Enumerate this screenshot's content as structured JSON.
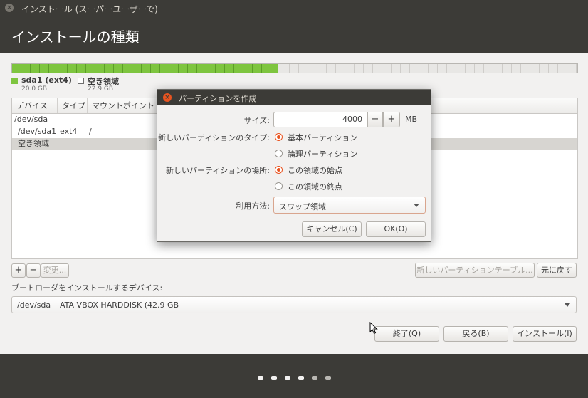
{
  "window": {
    "title": "インストール (スーパーユーザーで)"
  },
  "header": {
    "title": "インストールの種類"
  },
  "disk_usage": {
    "used_fraction": 0.47,
    "used_color": "#7ec53f"
  },
  "legend": [
    {
      "name": "sda1 (ext4)",
      "size": "20.0 GB",
      "color": "#7ec53f"
    },
    {
      "name": "空き領域",
      "size": "22.9 GB",
      "color": "#ffffff"
    }
  ],
  "table": {
    "columns": [
      "デバイス",
      "タイプ",
      "マウントポイント"
    ],
    "rows": [
      {
        "device": "/dev/sda",
        "type": "",
        "mount": ""
      },
      {
        "device": "/dev/sda1",
        "type": "ext4",
        "mount": "/"
      },
      {
        "device": "空き領域",
        "type": "",
        "mount": ""
      }
    ]
  },
  "toolbar": {
    "add": "+",
    "remove": "−",
    "change": "変更...",
    "new_table": "新しいパーティションテーブル...",
    "revert": "元に戻す"
  },
  "bootloader": {
    "label": "ブートローダをインストールするデバイス:",
    "device": "/dev/sda",
    "description": "ATA VBOX HARDDISK (42.9 GB"
  },
  "buttons": {
    "quit": "終了(Q)",
    "back": "戻る(B)",
    "install": "インストール(I)"
  },
  "dialog": {
    "title": "パーティションを作成",
    "size_label": "サイズ:",
    "size_value": "4000",
    "minus": "−",
    "plus": "+",
    "unit": "MB",
    "type_label": "新しいパーティションのタイプ:",
    "type_primary": "基本パーティション",
    "type_logical": "論理パーティション",
    "location_label": "新しいパーティションの場所:",
    "location_start": "この領域の始点",
    "location_end": "この領域の終点",
    "use_label": "利用方法:",
    "use_value": "スワップ領域",
    "cancel": "キャンセル(C)",
    "ok": "OK(O)",
    "accent_color": "#e95420"
  },
  "progress_dots": {
    "total": 6,
    "active": 3
  }
}
